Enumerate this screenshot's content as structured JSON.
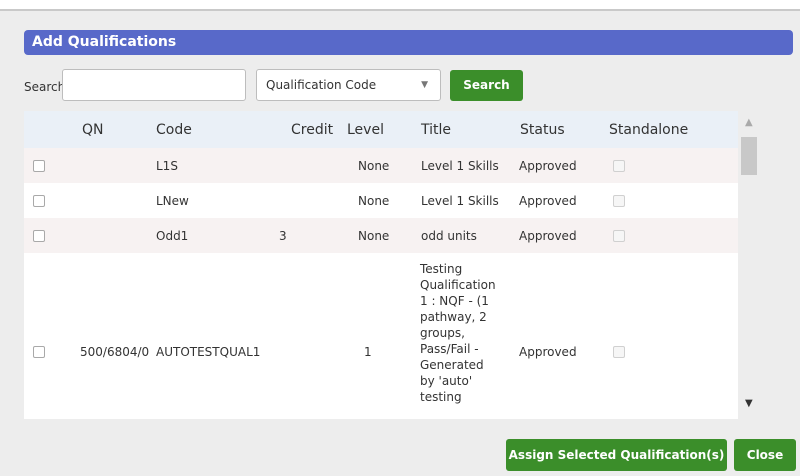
{
  "dialog": {
    "title": "Add Qualifications"
  },
  "search": {
    "label": "Search",
    "value": "",
    "placeholder": "",
    "field_select": "Qualification Code",
    "button_label": "Search"
  },
  "table": {
    "headers": [
      "QN",
      "Code",
      "Credit",
      "Level",
      "Title",
      "Status",
      "Standalone"
    ],
    "rows": [
      {
        "qn": "",
        "code": "L1S",
        "credit": "",
        "level": "None",
        "title": "Level 1 Skills",
        "status": "Approved"
      },
      {
        "qn": "",
        "code": "LNew",
        "credit": "",
        "level": "None",
        "title": "Level 1 Skills",
        "status": "Approved"
      },
      {
        "qn": "",
        "code": "Odd1",
        "credit": "3",
        "level": "None",
        "title": "odd units",
        "status": "Approved"
      },
      {
        "qn": "500/6804/0",
        "code": "AUTOTESTQUAL1",
        "credit": "",
        "level": "1",
        "title_lines": [
          "Testing",
          "Qualification",
          "1 : NQF - (1",
          "pathway, 2",
          "groups,",
          "Pass/Fail -",
          "Generated",
          "by 'auto'",
          "testing"
        ],
        "status": "Approved"
      }
    ]
  },
  "footer": {
    "assign_label": "Assign Selected Qualification(s)",
    "close_label": "Close"
  }
}
